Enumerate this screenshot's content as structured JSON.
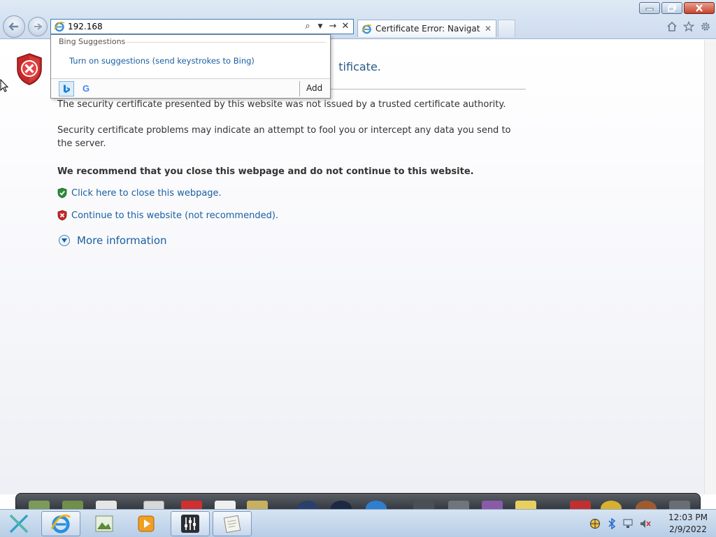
{
  "browser": {
    "address_value": "192.168",
    "tab_title": "Certificate Error: Navigatio...",
    "window_controls": [
      "minimize-icon",
      "restore-icon",
      "close-icon"
    ],
    "toolbar_icons": [
      "home-icon",
      "favorites-star-icon",
      "gear-icon"
    ]
  },
  "page": {
    "title_visible": "tificate.",
    "para1": "The security certificate presented by this website was not issued by a trusted certificate authority.",
    "para2": "Security certificate problems may indicate an attempt to fool you or intercept any data you send to the server.",
    "recommend": "We recommend that you close this webpage and do not continue to this website.",
    "close_link": "Click here to close this webpage.",
    "continue_link": "Continue to this website (not recommended).",
    "more_info": "More information"
  },
  "suggestions": {
    "header": "Bing Suggestions",
    "turn_on": "Turn on suggestions (send keystrokes to Bing)",
    "add_label": "Add",
    "google_glyph": "G"
  },
  "taskbar": {
    "time": "12:03 PM",
    "date": "2/9/2022"
  },
  "colors": {
    "link": "#1a5fa0",
    "title": "#2a5a8a",
    "shield_red": "#c62828",
    "shield_green": "#2e8b3a"
  }
}
